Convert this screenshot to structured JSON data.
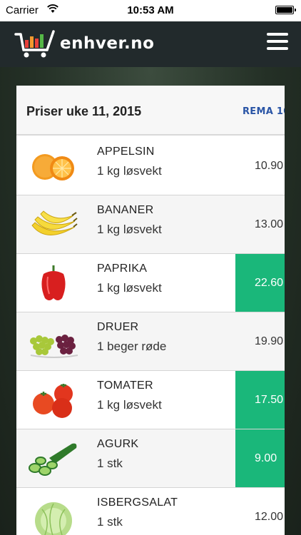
{
  "status_bar": {
    "carrier": "Carrier",
    "time": "10:53 AM"
  },
  "header": {
    "logo_text": "enhver.no",
    "logo_icon": "shopping-cart-bars-icon",
    "menu_icon": "hamburger-menu-icon"
  },
  "card": {
    "title": "Priser uke 11, 2015",
    "store_label": "REMA 10"
  },
  "colors": {
    "best_price": "#1ab77a",
    "header_bg": "#222a2c",
    "store_label": "#2a55a6"
  },
  "products": [
    {
      "name": "APPELSIN",
      "unit": "1 kg løsvekt",
      "price": "10.90",
      "best": false,
      "image": "orange-image"
    },
    {
      "name": "BANANER",
      "unit": "1 kg løsvekt",
      "price": "13.00",
      "best": false,
      "image": "banana-image"
    },
    {
      "name": "PAPRIKA",
      "unit": "1 kg løsvekt",
      "price": "22.60",
      "best": true,
      "image": "red-pepper-image"
    },
    {
      "name": "DRUER",
      "unit": "1 beger røde",
      "price": "19.90",
      "best": false,
      "image": "grapes-image"
    },
    {
      "name": "TOMATER",
      "unit": "1 kg løsvekt",
      "price": "17.50",
      "best": true,
      "image": "tomatoes-image"
    },
    {
      "name": "AGURK",
      "unit": "1 stk",
      "price": "9.00",
      "best": true,
      "image": "cucumber-image"
    },
    {
      "name": "ISBERGSALAT",
      "unit": "1 stk",
      "price": "12.00",
      "best": false,
      "image": "iceberg-lettuce-image"
    }
  ]
}
